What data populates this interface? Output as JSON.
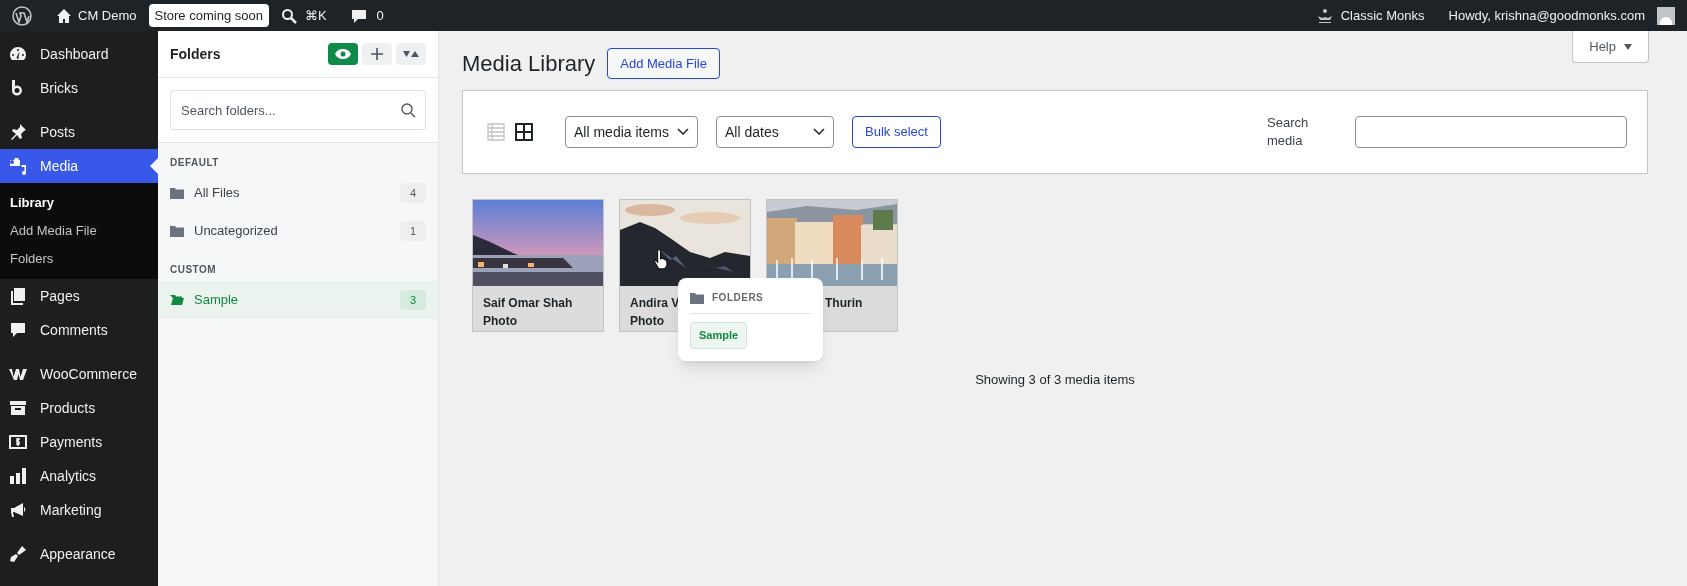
{
  "admin_bar": {
    "site": "CM Demo",
    "badge": "Store coming soon",
    "shortcut": "⌘K",
    "comments": "0",
    "brand": "Classic Monks",
    "greeting": "Howdy, krishna@goodmonks.com"
  },
  "sidebar": {
    "groups": [
      [
        {
          "label": "Dashboard",
          "selected": false
        },
        {
          "label": "Bricks",
          "selected": false
        }
      ],
      [
        {
          "label": "Posts",
          "selected": false
        },
        {
          "label": "Media",
          "selected": true,
          "children": [
            {
              "label": "Library",
              "selected": true
            },
            {
              "label": "Add Media File",
              "selected": false
            },
            {
              "label": "Folders",
              "selected": false
            }
          ]
        },
        {
          "label": "Pages",
          "selected": false
        },
        {
          "label": "Comments",
          "selected": false
        }
      ],
      [
        {
          "label": "WooCommerce",
          "selected": false
        },
        {
          "label": "Products",
          "selected": false
        },
        {
          "label": "Payments",
          "selected": false
        },
        {
          "label": "Analytics",
          "selected": false
        },
        {
          "label": "Marketing",
          "selected": false
        }
      ],
      [
        {
          "label": "Appearance",
          "selected": false
        }
      ]
    ]
  },
  "folders": {
    "title": "Folders",
    "eye_on": true,
    "search_placeholder": "Search folders...",
    "sections": [
      {
        "heading": "DEFAULT",
        "items": [
          {
            "name": "All Files",
            "count": "4",
            "selected": false
          },
          {
            "name": "Uncategorized",
            "count": "1",
            "selected": false
          }
        ]
      },
      {
        "heading": "CUSTOM",
        "items": [
          {
            "name": "Sample",
            "count": "3",
            "selected": true
          }
        ]
      }
    ]
  },
  "main": {
    "title": "Media Library",
    "add_button": "Add Media File",
    "help": "Help",
    "toolbar": {
      "views": [
        {
          "kind": "list",
          "selected": false
        },
        {
          "kind": "grid",
          "selected": true
        }
      ],
      "filters": [
        "All media items",
        "All dates"
      ],
      "bulk": "Bulk select",
      "search_label": "Search media"
    },
    "tiles": [
      {
        "lines": [
          "Saif Omar Shah",
          "Photo"
        ]
      },
      {
        "lines": [
          "Andira V",
          "Photo"
        ]
      },
      {
        "lines": [
          "Thurin"
        ]
      }
    ],
    "popover": {
      "heading": "FOLDERS",
      "tags": [
        "Sample"
      ]
    },
    "status": "Showing 3 of 3 media items"
  }
}
